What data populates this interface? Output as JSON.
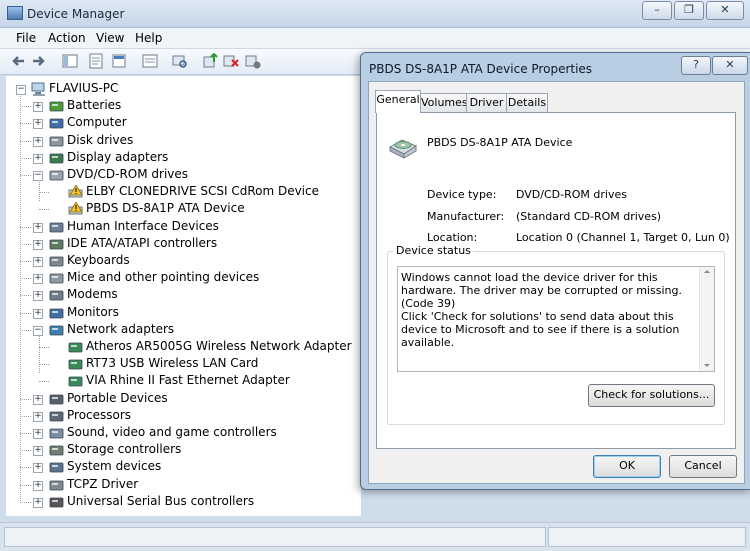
{
  "window": {
    "title": "Device Manager",
    "caption_buttons": [
      "–",
      "❐",
      "✕"
    ]
  },
  "menu": [
    "File",
    "Action",
    "View",
    "Help"
  ],
  "tree": {
    "root": "FLAVIUS-PC",
    "items": [
      {
        "label": "Batteries",
        "icon": "battery-icon",
        "expanded": false
      },
      {
        "label": "Computer",
        "icon": "computer-icon",
        "expanded": false
      },
      {
        "label": "Disk drives",
        "icon": "disk-drive-icon",
        "expanded": false
      },
      {
        "label": "Display adapters",
        "icon": "display-adapter-icon",
        "expanded": false
      },
      {
        "label": "DVD/CD-ROM drives",
        "icon": "dvd-drive-icon",
        "expanded": true
      },
      {
        "label": "ELBY CLONEDRIVE SCSI CdRom Device",
        "icon": "dvd-warning-icon",
        "child": true
      },
      {
        "label": "PBDS DS-8A1P ATA Device",
        "icon": "dvd-warning-icon",
        "child": true
      },
      {
        "label": "Human Interface Devices",
        "icon": "hid-icon",
        "expanded": false
      },
      {
        "label": "IDE ATA/ATAPI controllers",
        "icon": "ide-controller-icon",
        "expanded": false
      },
      {
        "label": "Keyboards",
        "icon": "keyboard-icon",
        "expanded": false
      },
      {
        "label": "Mice and other pointing devices",
        "icon": "mouse-icon",
        "expanded": false
      },
      {
        "label": "Modems",
        "icon": "modem-icon",
        "expanded": false
      },
      {
        "label": "Monitors",
        "icon": "monitor-icon",
        "expanded": false
      },
      {
        "label": "Network adapters",
        "icon": "network-adapter-icon",
        "expanded": true
      },
      {
        "label": "Atheros AR5005G Wireless Network Adapter",
        "icon": "network-card-icon",
        "child": true
      },
      {
        "label": "RT73 USB Wireless LAN Card",
        "icon": "network-card-icon",
        "child": true
      },
      {
        "label": "VIA Rhine II Fast Ethernet Adapter",
        "icon": "network-card-icon",
        "child": true
      },
      {
        "label": "Portable Devices",
        "icon": "portable-device-icon",
        "expanded": false
      },
      {
        "label": "Processors",
        "icon": "processor-icon",
        "expanded": false
      },
      {
        "label": "Sound, video and game controllers",
        "icon": "sound-icon",
        "expanded": false
      },
      {
        "label": "Storage controllers",
        "icon": "storage-controller-icon",
        "expanded": false
      },
      {
        "label": "System devices",
        "icon": "system-device-icon",
        "expanded": false
      },
      {
        "label": "TCPZ Driver",
        "icon": "driver-icon",
        "expanded": false
      },
      {
        "label": "Universal Serial Bus controllers",
        "icon": "usb-icon",
        "expanded": false
      }
    ]
  },
  "dialog": {
    "title": "PBDS DS-8A1P ATA Device Properties",
    "help_button": "?",
    "close_button": "✕",
    "tabs": [
      "General",
      "Volumes",
      "Driver",
      "Details"
    ],
    "active_tab": "General",
    "device_name": "PBDS DS-8A1P ATA Device",
    "properties": {
      "type_label": "Device type:",
      "type_value": "DVD/CD-ROM drives",
      "manufacturer_label": "Manufacturer:",
      "manufacturer_value": "(Standard CD-ROM drives)",
      "location_label": "Location:",
      "location_value": "Location 0 (Channel 1, Target 0, Lun 0)"
    },
    "status_group_label": "Device status",
    "status_text_1": "Windows cannot load the device driver for this hardware. The driver may be corrupted or missing. (Code 39)",
    "status_text_2": "Click 'Check for solutions' to send data about this device to Microsoft and to see if there is a solution available.",
    "check_button": "Check for solutions...",
    "ok_button": "OK",
    "cancel_button": "Cancel"
  },
  "colors": {
    "chrome": "#cfdcea",
    "dialog_frame": "#b9cde3",
    "warning": "#f2c230"
  }
}
